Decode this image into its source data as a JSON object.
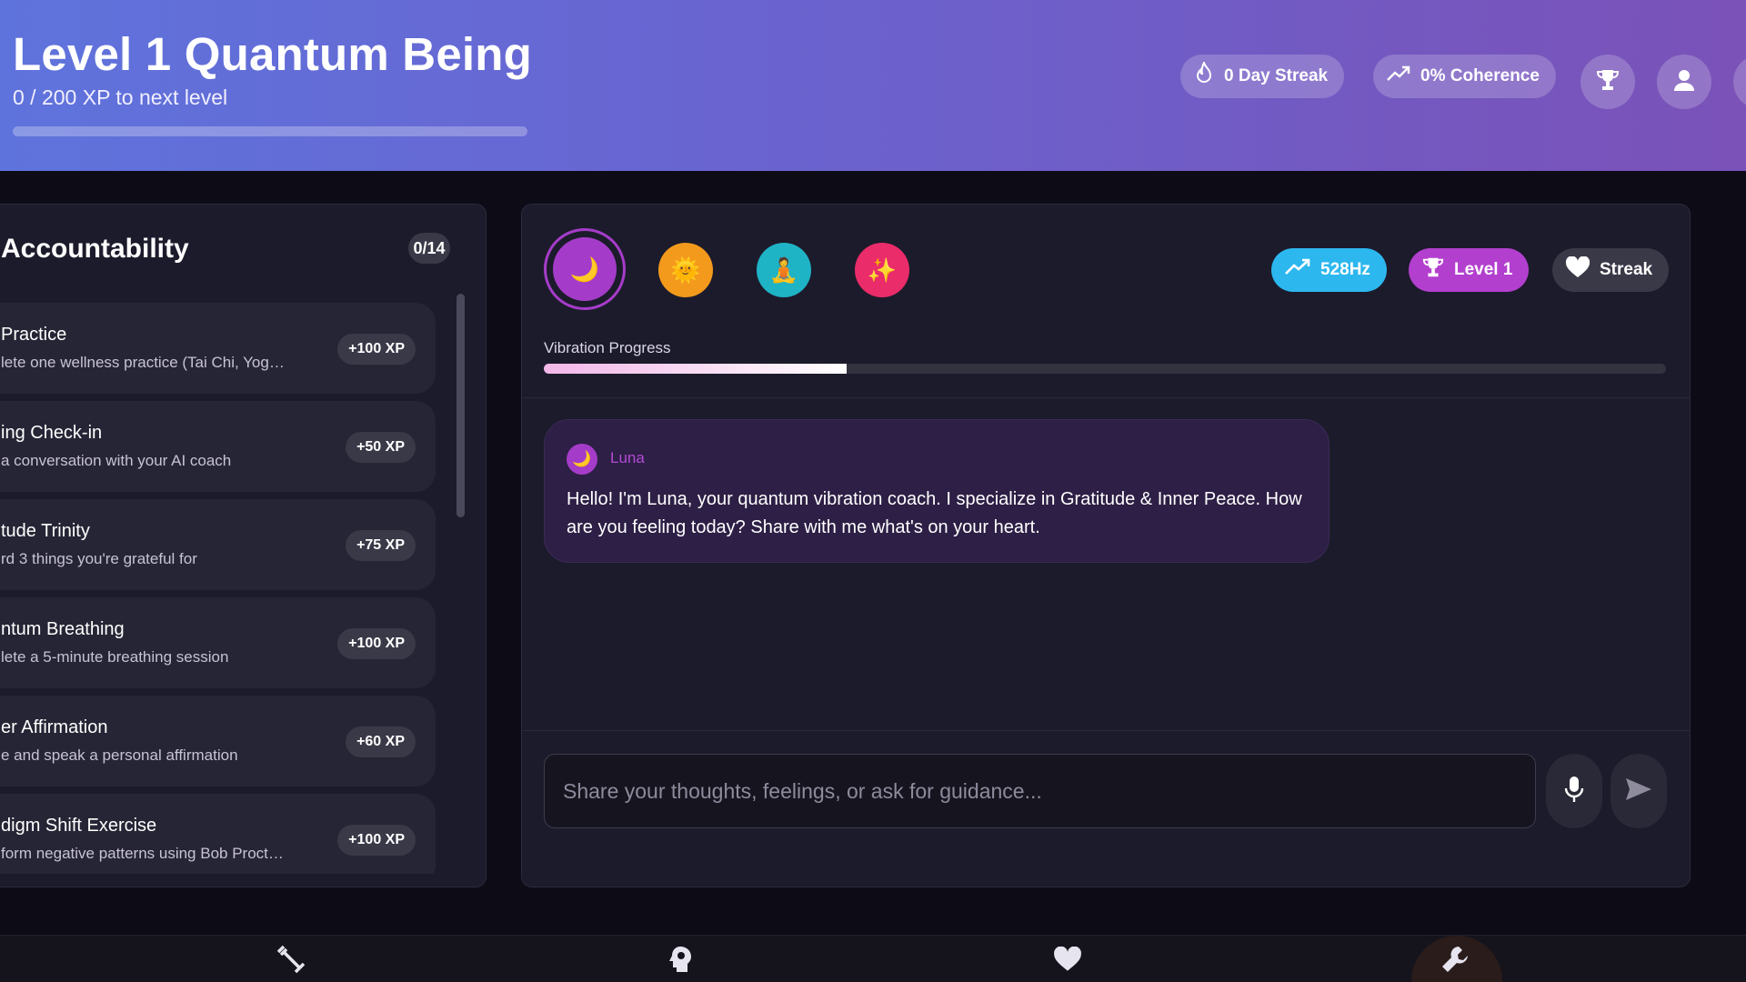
{
  "header": {
    "title": "Level 1 Quantum Being",
    "subtitle": "0 / 200 XP to next level",
    "xp_progress": 0,
    "streak_label": "0 Day Streak",
    "coherence_label": "0% Coherence",
    "icons": [
      "flame-icon",
      "trending-up-icon",
      "trophy-icon",
      "user-icon"
    ]
  },
  "accountability": {
    "title": "Accountability",
    "count": "0/14",
    "tasks": [
      {
        "name": "Practice",
        "desc": "lete one wellness practice (Tai Chi, Yoga,...",
        "xp": "+100 XP"
      },
      {
        "name": "ing Check-in",
        "desc": "a conversation with your AI coach",
        "xp": "+50 XP"
      },
      {
        "name": "tude Trinity",
        "desc": "rd 3 things you're grateful for",
        "xp": "+75 XP"
      },
      {
        "name": "ntum Breathing",
        "desc": "lete a 5-minute breathing session",
        "xp": "+100 XP"
      },
      {
        "name": "er Affirmation",
        "desc": "e and speak a personal affirmation",
        "xp": "+60 XP"
      },
      {
        "name": "digm Shift Exercise",
        "desc": "form negative patterns using Bob Proctor's",
        "xp": "+100 XP"
      }
    ]
  },
  "coaches": [
    {
      "name": "moon",
      "emoji": "🌙",
      "color": "#a53cc9",
      "selected": true
    },
    {
      "name": "sun",
      "emoji": "🌞",
      "color": "#f39a1c",
      "selected": false
    },
    {
      "name": "meditate",
      "emoji": "🧘",
      "color": "#1fb3c6",
      "selected": false
    },
    {
      "name": "sparkle",
      "emoji": "✨",
      "color": "#ea2c6a",
      "selected": false
    }
  ],
  "stats": {
    "frequency": "528Hz",
    "level": "Level 1",
    "streak": "Streak",
    "colors": {
      "frequency": "#2db7ef",
      "level": "#b33fcf",
      "streak": "#3a3948"
    }
  },
  "vibration": {
    "label": "Vibration Progress",
    "progress": 0.27
  },
  "message": {
    "sender": "Luna",
    "avatar": "🌙",
    "text": "Hello! I'm Luna, your quantum vibration coach. I specialize in Gratitude & Inner Peace. How are you feeling today? Share with me what's on your heart."
  },
  "input": {
    "placeholder": "Share your thoughts, feelings, or ask for guidance...",
    "value": ""
  },
  "nav": {
    "items": [
      "dumbbell-icon",
      "brain-icon",
      "heart-icon",
      "wrench-icon"
    ],
    "active": "wrench-icon"
  }
}
